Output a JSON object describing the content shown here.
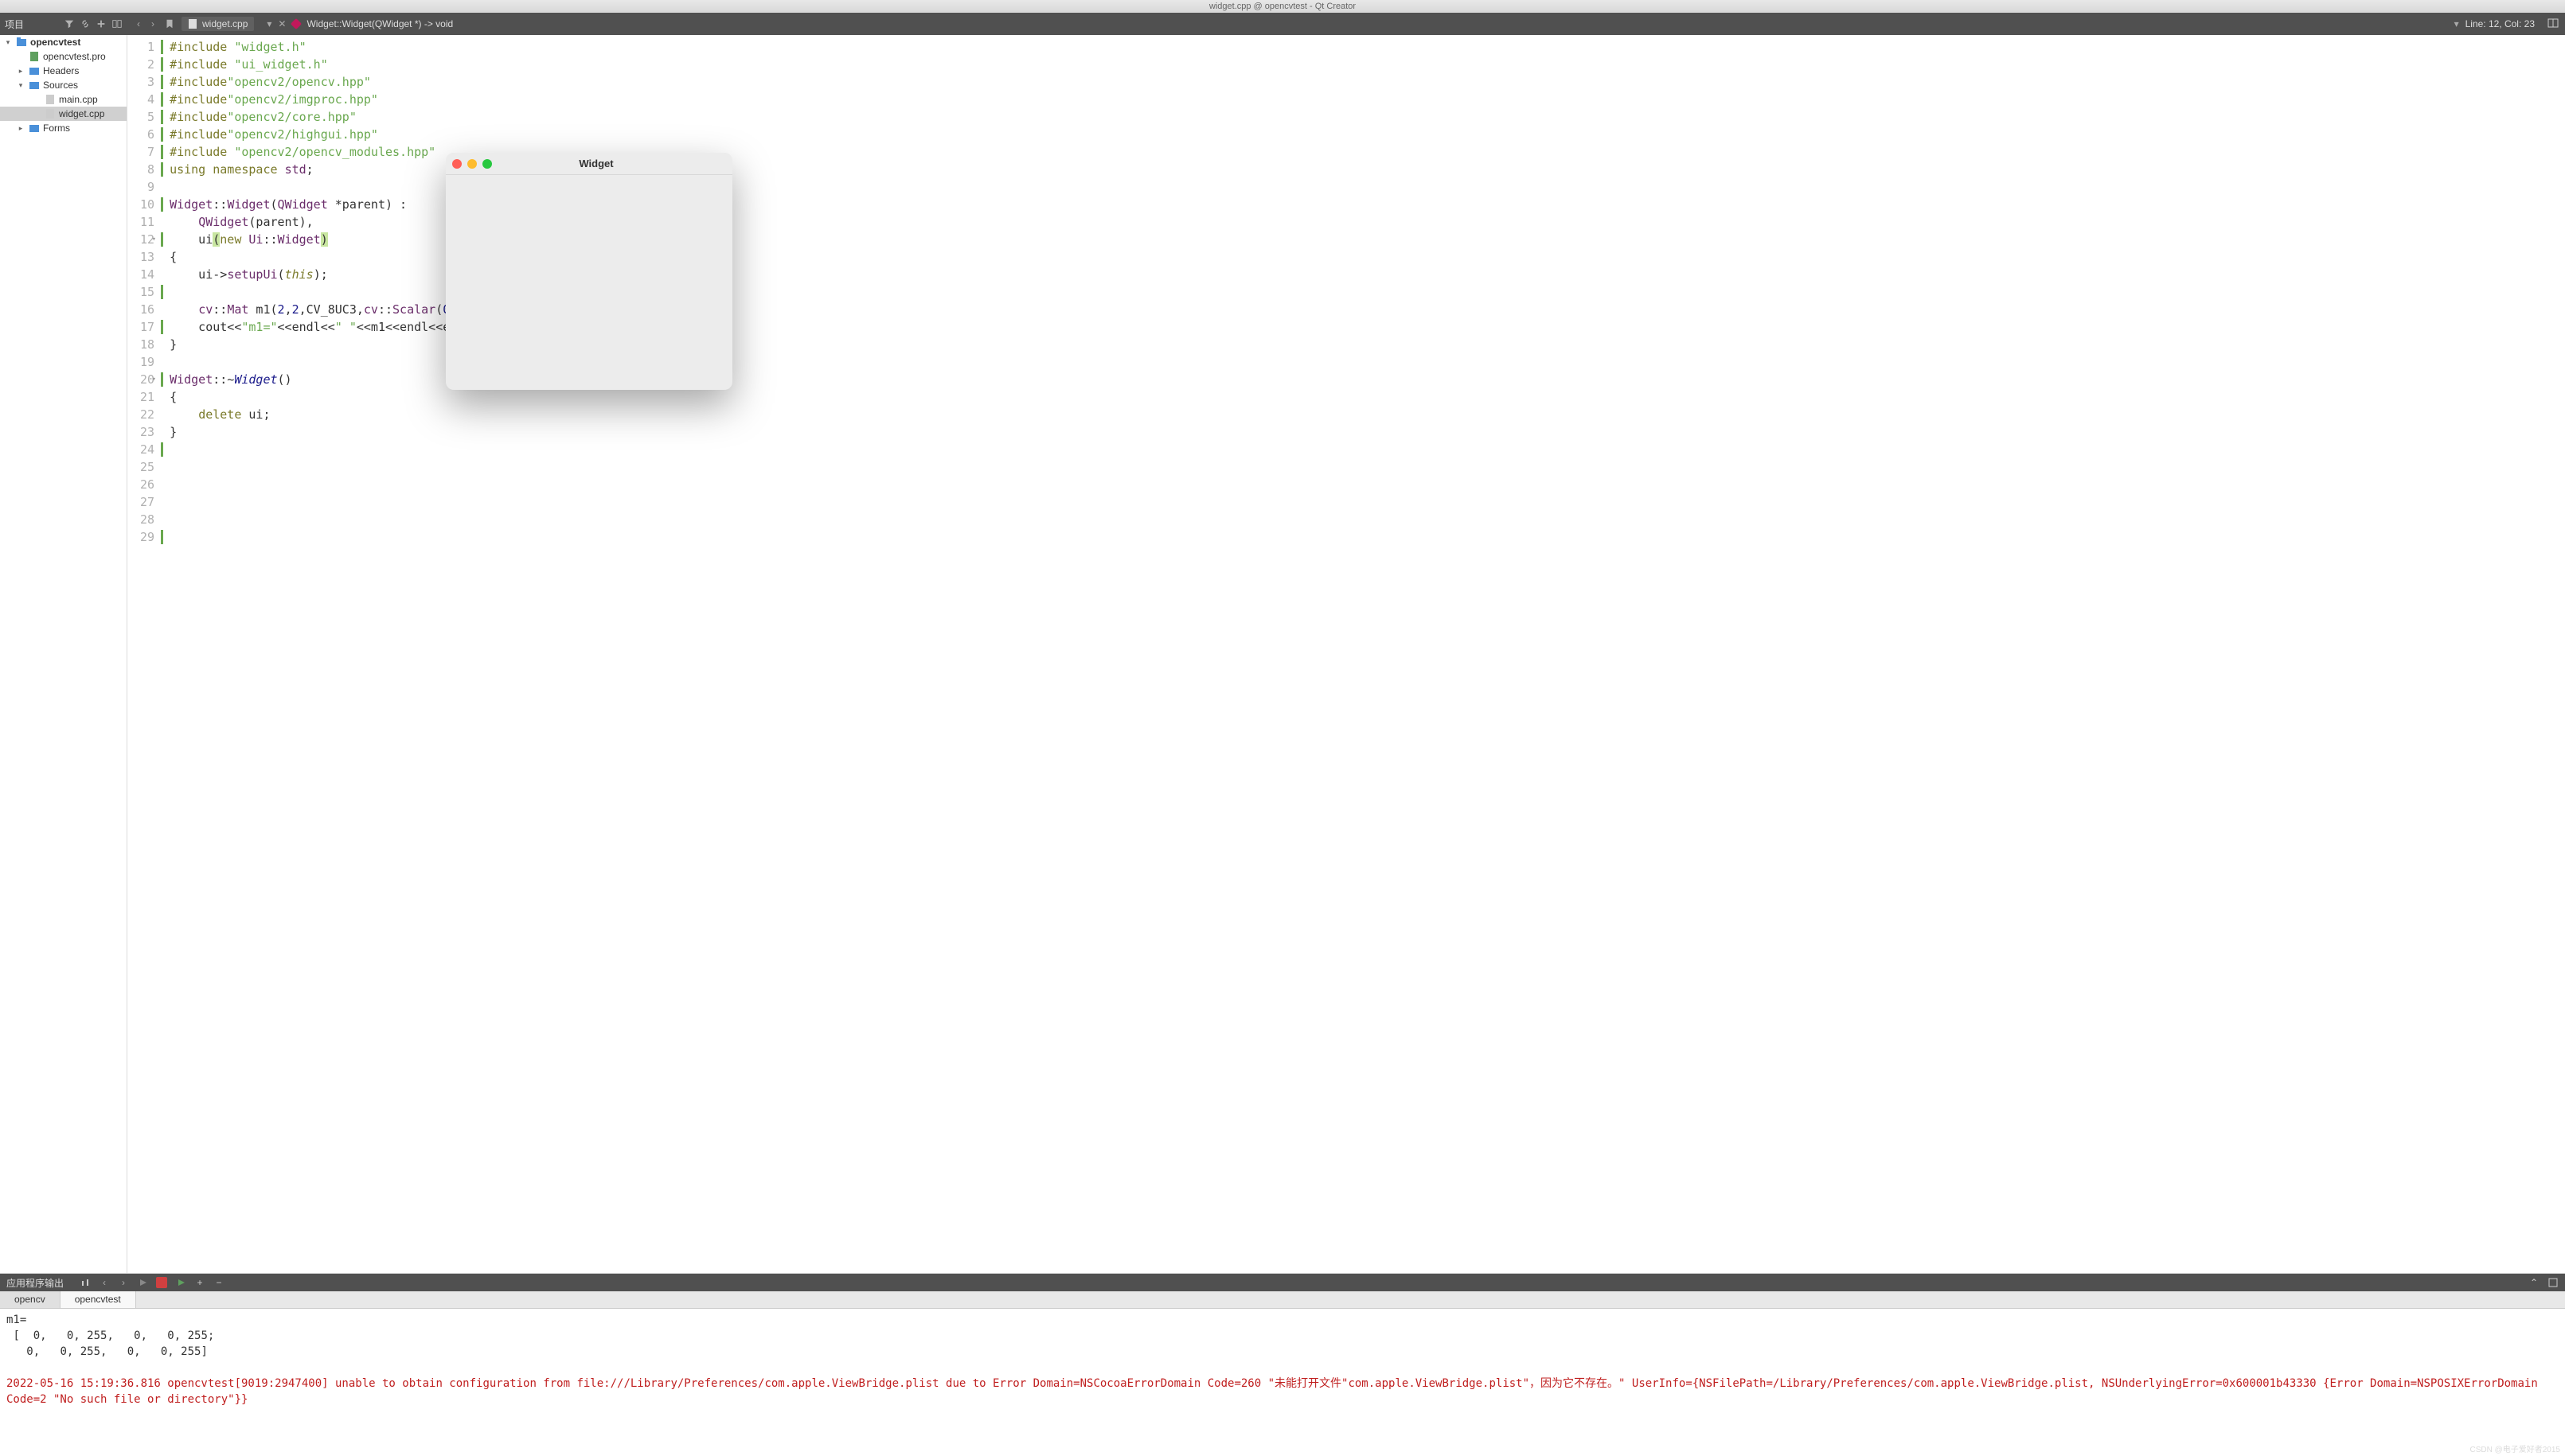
{
  "window_title": "widget.cpp @ opencvtest - Qt Creator",
  "topbar": {
    "project_label": "项目",
    "nav_prev": "‹",
    "nav_next": "›",
    "filename": "widget.cpp",
    "breadcrumb": "Widget::Widget(QWidget *) -> void",
    "line_col": "Line: 12, Col: 23"
  },
  "tree": {
    "root": "opencvtest",
    "pro": "opencvtest.pro",
    "headers": "Headers",
    "sources": "Sources",
    "main_cpp": "main.cpp",
    "widget_cpp": "widget.cpp",
    "forms": "Forms"
  },
  "code": {
    "lines": [
      "1",
      "2",
      "3",
      "4",
      "5",
      "6",
      "7",
      "8",
      "9",
      "10",
      "11",
      "12",
      "13",
      "14",
      "15",
      "16",
      "17",
      "18",
      "19",
      "20",
      "21",
      "22",
      "23",
      "24",
      "25",
      "26",
      "27",
      "28",
      "29"
    ]
  },
  "output": {
    "title": "应用程序输出",
    "tab1": "opencv",
    "tab2": "opencvtest",
    "line1": "m1=",
    "line2": " [  0,   0, 255,   0,   0, 255;",
    "line3": "   0,   0, 255,   0,   0, 255]",
    "err": "2022-05-16 15:19:36.816 opencvtest[9019:2947400] unable to obtain configuration from file:///Library/Preferences/com.apple.ViewBridge.plist due to Error Domain=NSCocoaErrorDomain Code=260 \"未能打开文件\"com.apple.ViewBridge.plist\"，因为它不存在。\" UserInfo={NSFilePath=/Library/Preferences/com.apple.ViewBridge.plist, NSUnderlyingError=0x600001b43330 {Error Domain=NSPOSIXErrorDomain Code=2 \"No such file or directory\"}}"
  },
  "float": {
    "title": "Widget"
  },
  "watermark": "CSDN @电子爱好者2015"
}
